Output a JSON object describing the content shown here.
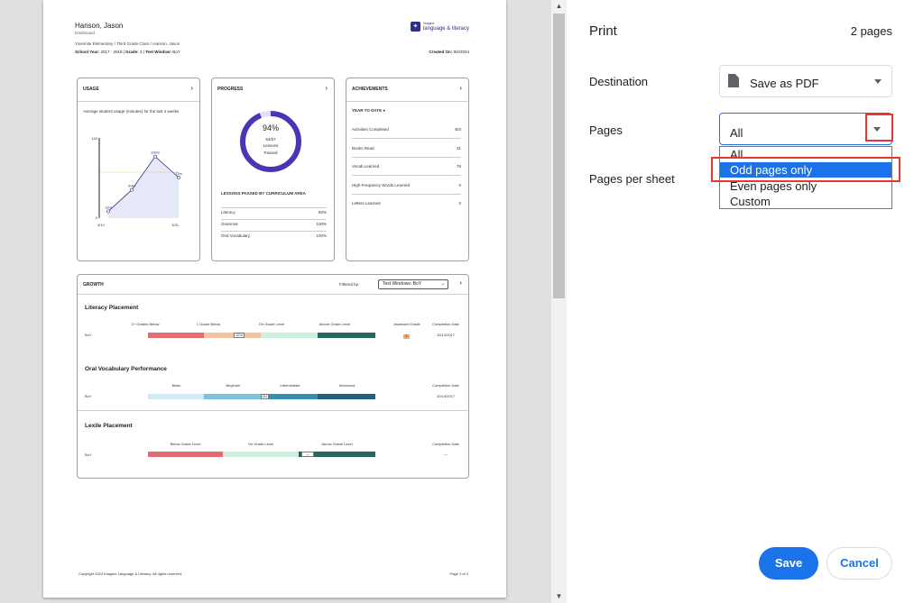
{
  "report": {
    "student_name": "Hanson, Jason",
    "subtitle": "Dashboard",
    "class_path": "Yosemite Elementary / Third Grade Class / Hanson, Jason",
    "school_year_label": "School Year:",
    "school_year": "2017 - 2018",
    "grade_label": "Grade:",
    "grade": "3",
    "test_window_label": "Test Window:",
    "test_window": "BoY",
    "created_label": "Created On:",
    "created_on": "9/4/2024",
    "logo_top": "Imagine",
    "logo_bottom": "language & literacy",
    "logo_mark": "✦"
  },
  "usage": {
    "title": "USAGE",
    "description": "Average student usage (minutes) for the last 4 weeks",
    "y_max_label": "142",
    "y_min_label": "0",
    "x_start": "3/10",
    "x_end": "3/31",
    "points": [
      {
        "label": "12m",
        "value": 12
      },
      {
        "label": "50m",
        "value": 50
      },
      {
        "label": "109m",
        "value": 109
      },
      {
        "label": "72m",
        "value": 72
      }
    ]
  },
  "progress": {
    "title": "PROGRESS",
    "percent": "94%",
    "ratio": "54/57",
    "caption1": "Lessons",
    "caption2": "Passed",
    "fraction": 0.94,
    "area_title": "LESSONS PASSED BY CURRICULUM AREA",
    "areas": [
      {
        "name": "Literacy",
        "value": "80%"
      },
      {
        "name": "Grammar",
        "value": "100%"
      },
      {
        "name": "Oral Vocabulary",
        "value": "100%"
      }
    ]
  },
  "achievements": {
    "title": "ACHIEVEMENTS",
    "subtitle": "YEAR TO DATE",
    "rows": [
      {
        "name": "Activities Completed",
        "value": "403"
      },
      {
        "name": "Books Read",
        "value": "31"
      },
      {
        "name": "Vocab Learned",
        "value": "78"
      },
      {
        "name": "High-Frequency Words Learned",
        "value": "0"
      },
      {
        "name": "Letters Learned",
        "value": "0"
      }
    ]
  },
  "growth": {
    "title": "GROWTH",
    "filter_label": "Filtered by:",
    "filter_value": "Test Windows: BoY",
    "literacy": {
      "title": "Literacy Placement",
      "cols": [
        "2+ Grades Below",
        "1 Grade Below",
        "On Grade Level",
        "Above Grade Level",
        "Assessed Grade",
        "Completion Date"
      ],
      "row_label": "BoY",
      "marker": "1214",
      "assessed": "2",
      "date": "10/13/2017"
    },
    "oral": {
      "title": "Oral Vocabulary Performance",
      "cols": [
        "Basic",
        "Beginner",
        "Intermediate",
        "Advanced",
        "Completion Date"
      ],
      "row_label": "BoY",
      "marker": "611",
      "date": "10/13/2017"
    },
    "lexile": {
      "title": "Lexile Placement",
      "cols": [
        "Below Grade Level",
        "On Grade Level",
        "Above Grade Level",
        "Completion Date"
      ],
      "row_label": "BoY",
      "marker": "—",
      "date": "—"
    }
  },
  "footer": {
    "copyright": "Copyright 2024 Imagine Language & Literacy. All rights reserved.",
    "page": "Page 1 of 2"
  },
  "print_panel": {
    "title": "Print",
    "page_count": "2 pages",
    "destination_label": "Destination",
    "destination_value": "Save as PDF",
    "pages_label": "Pages",
    "pages_value": "All",
    "pages_per_sheet_label": "Pages per sheet",
    "pages_options": [
      "All",
      "Odd pages only",
      "Even pages only",
      "Custom"
    ],
    "highlighted_option": "Odd pages only",
    "save_label": "Save",
    "cancel_label": "Cancel",
    "accent_color": "#1a73e8",
    "highlight_box_color": "#e53935"
  }
}
